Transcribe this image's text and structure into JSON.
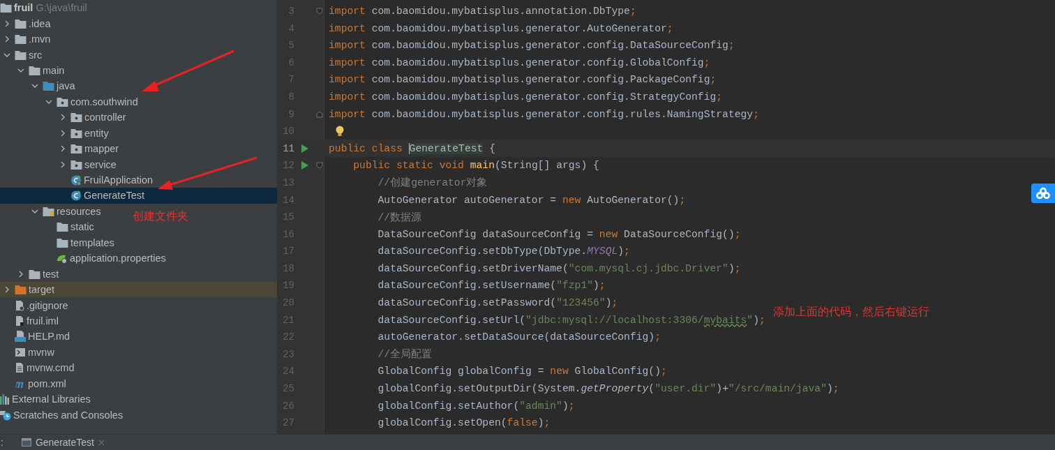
{
  "project_tree": {
    "root": {
      "name": "fruil",
      "path": "G:\\java\\fruil",
      "kind": "project",
      "selected": false,
      "children": [
        {
          "name": ".idea",
          "kind": "folder",
          "expanded": false,
          "selected": false
        },
        {
          "name": ".mvn",
          "kind": "folder",
          "expanded": false,
          "selected": false
        },
        {
          "name": "src",
          "kind": "folder",
          "expanded": true,
          "selected": false,
          "children": [
            {
              "name": "main",
              "kind": "folder",
              "expanded": true,
              "selected": false,
              "children": [
                {
                  "name": "java",
                  "kind": "source-folder",
                  "expanded": true,
                  "selected": false,
                  "children": [
                    {
                      "name": "com.southwind",
                      "kind": "package",
                      "expanded": true,
                      "selected": false,
                      "children": [
                        {
                          "name": "controller",
                          "kind": "package",
                          "expanded": false,
                          "selected": false
                        },
                        {
                          "name": "entity",
                          "kind": "package",
                          "expanded": false,
                          "selected": false
                        },
                        {
                          "name": "mapper",
                          "kind": "package",
                          "expanded": false,
                          "selected": false
                        },
                        {
                          "name": "service",
                          "kind": "package",
                          "expanded": false,
                          "selected": false
                        },
                        {
                          "name": "FruilApplication",
                          "kind": "app-class",
                          "selected": false
                        },
                        {
                          "name": "GenerateTest",
                          "kind": "class",
                          "selected": true
                        }
                      ]
                    }
                  ]
                },
                {
                  "name": "resources",
                  "kind": "resources-folder",
                  "expanded": true,
                  "selected": false,
                  "children": [
                    {
                      "name": "static",
                      "kind": "folder",
                      "selected": false
                    },
                    {
                      "name": "templates",
                      "kind": "folder",
                      "selected": false
                    },
                    {
                      "name": "application.properties",
                      "kind": "properties",
                      "selected": false
                    }
                  ]
                }
              ]
            },
            {
              "name": "test",
              "kind": "folder",
              "expanded": false,
              "selected": false
            }
          ]
        },
        {
          "name": "target",
          "kind": "excluded-folder",
          "expanded": false,
          "selected": false
        },
        {
          "name": ".gitignore",
          "kind": "ignore-file",
          "selected": false
        },
        {
          "name": "fruil.iml",
          "kind": "module-file",
          "selected": false
        },
        {
          "name": "HELP.md",
          "kind": "markdown",
          "selected": false
        },
        {
          "name": "mvnw",
          "kind": "script",
          "selected": false
        },
        {
          "name": "mvnw.cmd",
          "kind": "text-file",
          "selected": false
        },
        {
          "name": "pom.xml",
          "kind": "maven",
          "selected": false
        }
      ]
    },
    "others": [
      {
        "name": "External Libraries",
        "kind": "libraries",
        "selected": false
      },
      {
        "name": "Scratches and Consoles",
        "kind": "scratches",
        "selected": false
      }
    ]
  },
  "editor": {
    "lines": [
      {
        "number": "3",
        "run": false,
        "current": false,
        "fold": {
          "kind": "start"
        },
        "tokens": [
          {
            "kind": "keyword",
            "text": "import "
          },
          {
            "kind": "plain",
            "text": "com.baomidou.mybatisplus.annotation.DbType"
          },
          {
            "kind": "semicolon",
            "text": ";"
          }
        ]
      },
      {
        "number": "4",
        "run": false,
        "current": false,
        "tokens": [
          {
            "kind": "keyword",
            "text": "import "
          },
          {
            "kind": "plain",
            "text": "com.baomidou.mybatisplus.generator.AutoGenerator"
          },
          {
            "kind": "semicolon",
            "text": ";"
          }
        ]
      },
      {
        "number": "5",
        "run": false,
        "current": false,
        "tokens": [
          {
            "kind": "keyword",
            "text": "import "
          },
          {
            "kind": "plain",
            "text": "com.baomidou.mybatisplus.generator.config.DataSourceConfig"
          },
          {
            "kind": "semicolon",
            "text": ";"
          }
        ]
      },
      {
        "number": "6",
        "run": false,
        "current": false,
        "tokens": [
          {
            "kind": "keyword",
            "text": "import "
          },
          {
            "kind": "plain",
            "text": "com.baomidou.mybatisplus.generator.config.GlobalConfig"
          },
          {
            "kind": "semicolon",
            "text": ";"
          }
        ]
      },
      {
        "number": "7",
        "run": false,
        "current": false,
        "tokens": [
          {
            "kind": "keyword",
            "text": "import "
          },
          {
            "kind": "plain",
            "text": "com.baomidou.mybatisplus.generator.config.PackageConfig"
          },
          {
            "kind": "semicolon",
            "text": ";"
          }
        ]
      },
      {
        "number": "8",
        "run": false,
        "current": false,
        "tokens": [
          {
            "kind": "keyword",
            "text": "import "
          },
          {
            "kind": "plain",
            "text": "com.baomidou.mybatisplus.generator.config.StrategyConfig"
          },
          {
            "kind": "semicolon",
            "text": ";"
          }
        ]
      },
      {
        "number": "9",
        "run": false,
        "current": false,
        "fold": {
          "kind": "end"
        },
        "tokens": [
          {
            "kind": "keyword",
            "text": "import "
          },
          {
            "kind": "plain",
            "text": "com.baomidou.mybatisplus.generator.config.rules.NamingStrategy"
          },
          {
            "kind": "semicolon",
            "text": ";"
          }
        ]
      },
      {
        "number": "10",
        "run": false,
        "current": false,
        "marker": {
          "kind": "bulb"
        }
      },
      {
        "number": "11",
        "run": true,
        "current": true,
        "tokens": [
          {
            "kind": "keyword",
            "text": "public class "
          },
          {
            "kind": "caret-highlight",
            "text": "GenerateTest"
          },
          {
            "kind": "plain",
            "text": " {"
          }
        ]
      },
      {
        "number": "12",
        "run": true,
        "current": false,
        "fold": {
          "kind": "start"
        },
        "tokens": [
          {
            "kind": "keyword",
            "text": "    public static void "
          },
          {
            "kind": "method",
            "text": "main"
          },
          {
            "kind": "plain",
            "text": "(String[] args) {"
          }
        ]
      },
      {
        "number": "13",
        "run": false,
        "current": false,
        "tokens": [
          {
            "kind": "comment",
            "text": "        //创建generator对象"
          }
        ]
      },
      {
        "number": "14",
        "run": false,
        "current": false,
        "tokens": [
          {
            "kind": "plain",
            "text": "        AutoGenerator autoGenerator = "
          },
          {
            "kind": "keyword",
            "text": "new "
          },
          {
            "kind": "plain",
            "text": "AutoGenerator()"
          },
          {
            "kind": "semicolon",
            "text": ";"
          }
        ]
      },
      {
        "number": "15",
        "run": false,
        "current": false,
        "tokens": [
          {
            "kind": "comment",
            "text": "        //数据源"
          }
        ]
      },
      {
        "number": "16",
        "run": false,
        "current": false,
        "tokens": [
          {
            "kind": "plain",
            "text": "        DataSourceConfig dataSourceConfig = "
          },
          {
            "kind": "keyword",
            "text": "new "
          },
          {
            "kind": "plain",
            "text": "DataSourceConfig()"
          },
          {
            "kind": "semicolon",
            "text": ";"
          }
        ]
      },
      {
        "number": "17",
        "run": false,
        "current": false,
        "tokens": [
          {
            "kind": "plain",
            "text": "        dataSourceConfig.setDbType(DbType."
          },
          {
            "kind": "constant",
            "text": "MYSQL"
          },
          {
            "kind": "plain",
            "text": ")"
          },
          {
            "kind": "semicolon",
            "text": ";"
          }
        ]
      },
      {
        "number": "18",
        "run": false,
        "current": false,
        "tokens": [
          {
            "kind": "plain",
            "text": "        dataSourceConfig.setDriverName("
          },
          {
            "kind": "string",
            "text": "\"com.mysql.cj.jdbc.Driver\""
          },
          {
            "kind": "plain",
            "text": ")"
          },
          {
            "kind": "semicolon",
            "text": ";"
          }
        ]
      },
      {
        "number": "19",
        "run": false,
        "current": false,
        "tokens": [
          {
            "kind": "plain",
            "text": "        dataSourceConfig.setUsername("
          },
          {
            "kind": "string",
            "text": "\"fzp1\""
          },
          {
            "kind": "plain",
            "text": ")"
          },
          {
            "kind": "semicolon",
            "text": ";"
          }
        ]
      },
      {
        "number": "20",
        "run": false,
        "current": false,
        "tokens": [
          {
            "kind": "plain",
            "text": "        dataSourceConfig.setPassword("
          },
          {
            "kind": "string",
            "text": "\"123456\""
          },
          {
            "kind": "plain",
            "text": ")"
          },
          {
            "kind": "semicolon",
            "text": ";"
          }
        ]
      },
      {
        "number": "21",
        "run": false,
        "current": false,
        "tokens": [
          {
            "kind": "plain",
            "text": "        dataSourceConfig.setUrl("
          },
          {
            "kind": "string",
            "text": "\"jdbc:mysql://localhost:3306/"
          },
          {
            "kind": "typo-string",
            "text": "mybaits"
          },
          {
            "kind": "string",
            "text": "\""
          },
          {
            "kind": "plain",
            "text": ")"
          },
          {
            "kind": "semicolon",
            "text": ";"
          }
        ]
      },
      {
        "number": "22",
        "run": false,
        "current": false,
        "tokens": [
          {
            "kind": "plain",
            "text": "        autoGenerator.setDataSource(dataSourceConfig)"
          },
          {
            "kind": "semicolon",
            "text": ";"
          }
        ]
      },
      {
        "number": "23",
        "run": false,
        "current": false,
        "tokens": [
          {
            "kind": "comment",
            "text": "        //全局配置"
          }
        ]
      },
      {
        "number": "24",
        "run": false,
        "current": false,
        "tokens": [
          {
            "kind": "plain",
            "text": "        GlobalConfig globalConfig = "
          },
          {
            "kind": "keyword",
            "text": "new "
          },
          {
            "kind": "plain",
            "text": "GlobalConfig()"
          },
          {
            "kind": "semicolon",
            "text": ";"
          }
        ]
      },
      {
        "number": "25",
        "run": false,
        "current": false,
        "tokens": [
          {
            "kind": "plain",
            "text": "        globalConfig.setOutputDir(System."
          },
          {
            "kind": "static-call",
            "text": "getProperty"
          },
          {
            "kind": "plain",
            "text": "("
          },
          {
            "kind": "string",
            "text": "\"user.dir\""
          },
          {
            "kind": "plain",
            "text": ")+"
          },
          {
            "kind": "string",
            "text": "\"/src/main/java\""
          },
          {
            "kind": "plain",
            "text": ")"
          },
          {
            "kind": "semicolon",
            "text": ";"
          }
        ]
      },
      {
        "number": "26",
        "run": false,
        "current": false,
        "tokens": [
          {
            "kind": "plain",
            "text": "        globalConfig.setAuthor("
          },
          {
            "kind": "string",
            "text": "\"admin\""
          },
          {
            "kind": "plain",
            "text": ")"
          },
          {
            "kind": "semicolon",
            "text": ";"
          }
        ]
      },
      {
        "number": "27",
        "run": false,
        "current": false,
        "tokens": [
          {
            "kind": "plain",
            "text": "        globalConfig.setOpen("
          },
          {
            "kind": "keyword",
            "text": "false"
          },
          {
            "kind": "plain",
            "text": ")"
          },
          {
            "kind": "semicolon",
            "text": ";"
          }
        ]
      }
    ]
  },
  "annotations": [
    {
      "text": "创建文件夹"
    },
    {
      "text": "添加上面的代码，然后右键运行"
    }
  ],
  "bottom_bar": {
    "label": ":",
    "tabs": [
      {
        "title": "GenerateTest",
        "selected": true
      }
    ]
  }
}
